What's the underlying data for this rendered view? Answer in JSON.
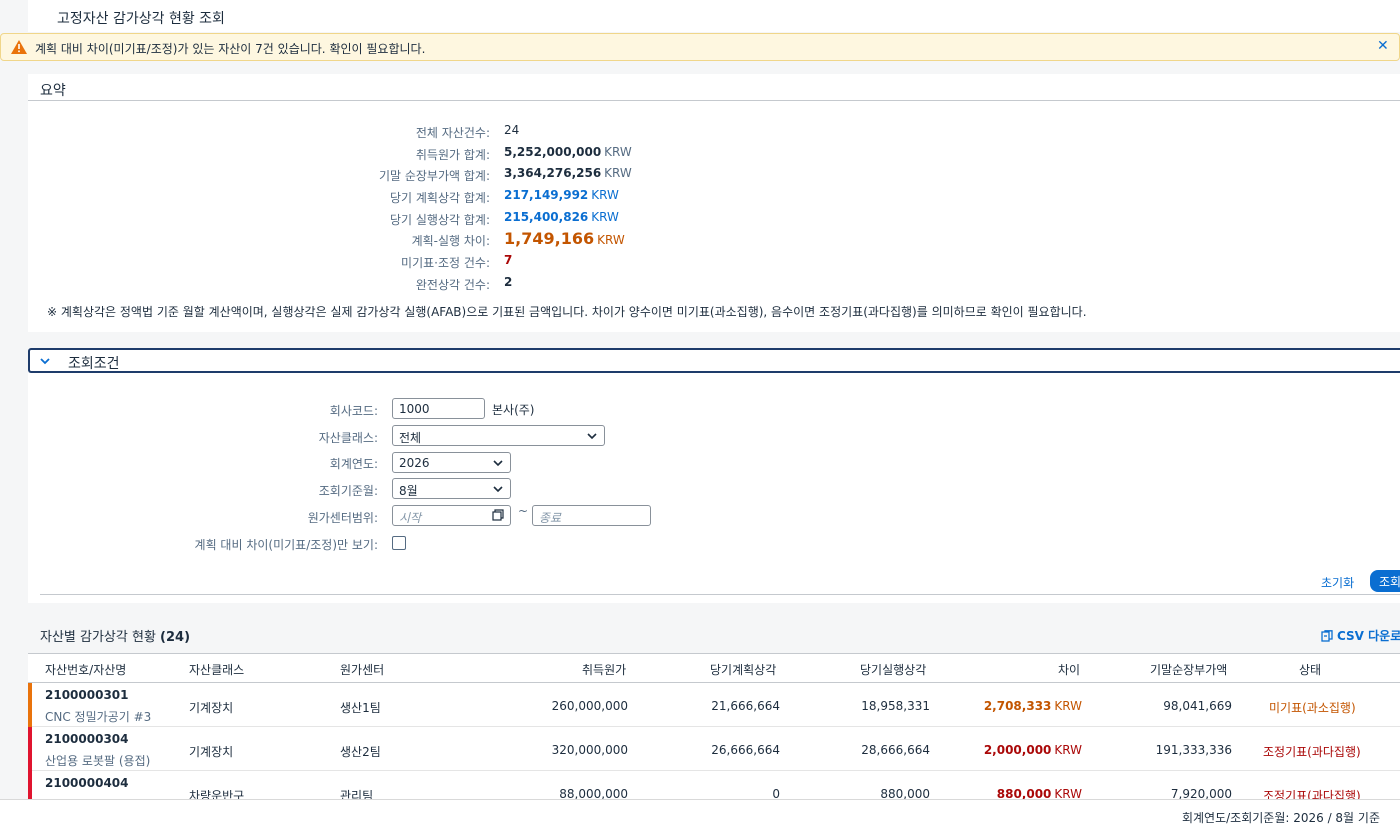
{
  "header": {
    "title": "고정자산 감가상각 현황 조회"
  },
  "message": {
    "text": "계획 대비 차이(미기표/조정)가 있는 자산이 7건 있습니다. 확인이 필요합니다.",
    "close_label": "✕"
  },
  "summary": {
    "title": "요약",
    "rows": [
      {
        "label": "전체 자산건수:",
        "value": "24",
        "unit": ""
      },
      {
        "label": "취득원가 합계:",
        "value": "5,252,000,000",
        "unit": "KRW"
      },
      {
        "label": "기말 순장부가액 합계:",
        "value": "3,364,276,256",
        "unit": "KRW"
      },
      {
        "label": "당기 계획상각 합계:",
        "value": "217,149,992",
        "unit": "KRW"
      },
      {
        "label": "당기 실행상각 합계:",
        "value": "215,400,826",
        "unit": "KRW"
      },
      {
        "label": "계획-실행 차이:",
        "value": "1,749,166",
        "unit": "KRW"
      },
      {
        "label": "미기표·조정 건수:",
        "value": "7",
        "unit": ""
      },
      {
        "label": "완전상각 건수:",
        "value": "2",
        "unit": ""
      }
    ],
    "note": "※ 계획상각은 정액법 기준 월할 계산액이며, 실행상각은 실제 감가상각 실행(AFAB)으로 기표된 금액입니다. 차이가 양수이면 미기표(과소집행), 음수이면 조정기표(과다집행)를 의미하므로 확인이 필요합니다."
  },
  "filter": {
    "title": "조회조건",
    "company_label": "회사코드:",
    "company_value": "1000",
    "company_name": "본사(주)",
    "class_label": "자산클래스:",
    "class_value": "전체",
    "year_label": "회계연도:",
    "year_value": "2026",
    "month_label": "조회기준월:",
    "month_value": "8월",
    "cc_label": "원가센터범위:",
    "cc_from_placeholder": "시작",
    "cc_tilde": "~",
    "cc_to_placeholder": "종료",
    "diff_only_label": "계획 대비 차이(미기표/조정)만 보기:",
    "diff_only_checked": false,
    "reset_label": "초기화",
    "go_label": "조회"
  },
  "table": {
    "title": "자산별 감가상각 현황",
    "count": "(24)",
    "csv_label": "CSV 다운로드",
    "columns": [
      "자산번호/자산명",
      "자산클래스",
      "원가센터",
      "취득원가",
      "당기계획상각",
      "당기실행상각",
      "차이",
      "기말순장부가액",
      "상태"
    ],
    "rows": [
      {
        "asset_no": "2100000301",
        "asset_name": "CNC 정밀가공기 #3",
        "class": "기계장치",
        "cost_center": "생산1팀",
        "acq": "260,000,000",
        "plan": "21,666,664",
        "actual": "18,958,331",
        "diff": "2,708,333",
        "diff_unit": "KRW",
        "nbv": "98,041,669",
        "status": "미기표(과소집행)",
        "tone": "orange",
        "bar": "#e9730c"
      },
      {
        "asset_no": "2100000304",
        "asset_name": "산업용 로봇팔 (용접)",
        "class": "기계장치",
        "cost_center": "생산2팀",
        "acq": "320,000,000",
        "plan": "26,666,664",
        "actual": "28,666,664",
        "diff": "2,000,000",
        "diff_unit": "KRW",
        "nbv": "191,333,336",
        "status": "조정기표(과다집행)",
        "tone": "red",
        "bar": "#e0142f"
      },
      {
        "asset_no": "2100000404",
        "asset_name": "",
        "class": "차량운반구",
        "cost_center": "관리팀",
        "acq": "88,000,000",
        "plan": "0",
        "actual": "880,000",
        "diff": "880,000",
        "diff_unit": "KRW",
        "nbv": "7,920,000",
        "status": "조정기표(과다집행)",
        "tone": "red",
        "bar": "#e0142f"
      }
    ]
  },
  "footer": {
    "text": "회계연도/조회기준월: 2026 / 8월 기준"
  }
}
